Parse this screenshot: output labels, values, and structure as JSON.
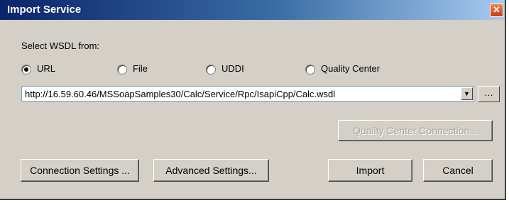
{
  "window": {
    "title": "Import Service",
    "close_symbol": "✕"
  },
  "source": {
    "label": "Select WSDL from:",
    "options": [
      {
        "label": "URL",
        "selected": true
      },
      {
        "label": "File",
        "selected": false
      },
      {
        "label": "UDDI",
        "selected": false
      },
      {
        "label": "Quality Center",
        "selected": false
      }
    ]
  },
  "url_field": {
    "value": "http://16.59.60.46/MSSoapSamples30/Calc/Service/Rpc/IsapiCpp/Calc.wsdl"
  },
  "buttons": {
    "qc_connection": "Quality Center Connection...",
    "connection_settings": "Connection Settings ...",
    "advanced_settings": "Advanced Settings...",
    "import": "Import",
    "cancel": "Cancel"
  },
  "icons": {
    "dropdown": "chevron-down-icon",
    "browse": "ellipsis-icon",
    "close": "close-icon"
  }
}
